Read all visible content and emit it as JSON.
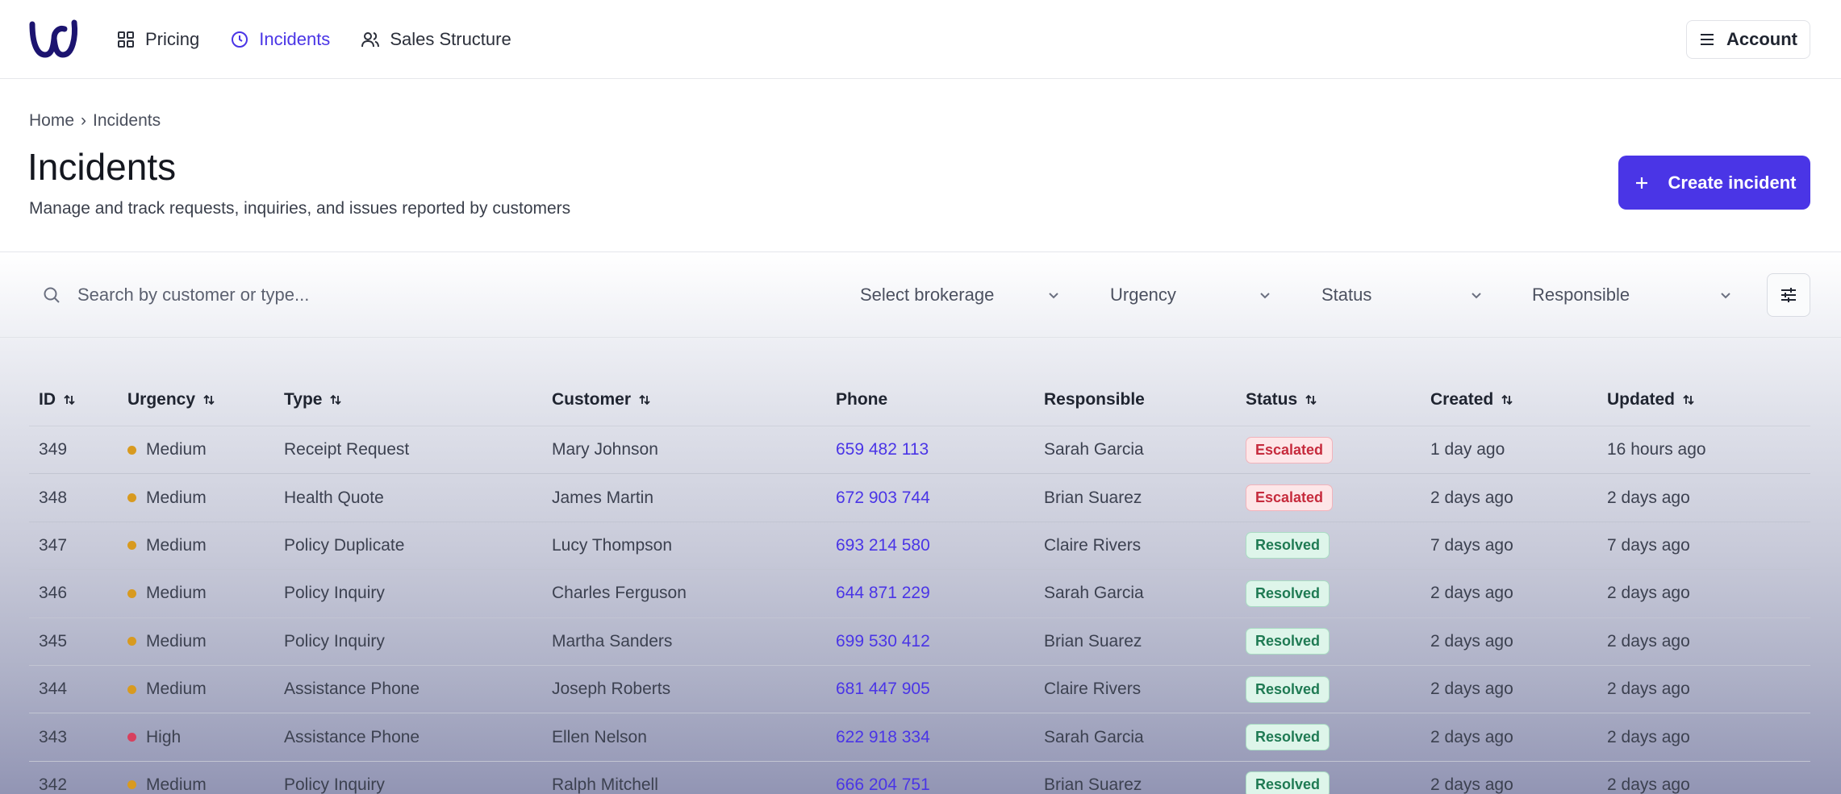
{
  "nav": {
    "items": [
      {
        "label": "Pricing",
        "icon": "grid-icon",
        "active": false
      },
      {
        "label": "Incidents",
        "icon": "clock-icon",
        "active": true
      },
      {
        "label": "Sales Structure",
        "icon": "users-icon",
        "active": false
      }
    ],
    "account_label": "Account"
  },
  "breadcrumb": {
    "home": "Home",
    "separator": "›",
    "current": "Incidents"
  },
  "page": {
    "title": "Incidents",
    "subtitle": "Manage and track requests, inquiries, and issues reported by customers",
    "create_label": "Create incident"
  },
  "filters": {
    "search_placeholder": "Search by customer or type...",
    "brokerage": "Select brokerage",
    "urgency": "Urgency",
    "status": "Status",
    "responsible": "Responsible"
  },
  "table": {
    "columns": [
      "ID",
      "Urgency",
      "Type",
      "Customer",
      "Phone",
      "Responsible",
      "Status",
      "Created",
      "Updated"
    ],
    "rows": [
      {
        "id": "349",
        "urgency": "Medium",
        "type": "Receipt Request",
        "customer": "Mary Johnson",
        "phone": "659 482 113",
        "responsible": "Sarah Garcia",
        "status": "Escalated",
        "created": "1 day ago",
        "updated": "16 hours ago"
      },
      {
        "id": "348",
        "urgency": "Medium",
        "type": "Health Quote",
        "customer": "James Martin",
        "phone": "672 903 744",
        "responsible": "Brian Suarez",
        "status": "Escalated",
        "created": "2 days ago",
        "updated": "2 days ago"
      },
      {
        "id": "347",
        "urgency": "Medium",
        "type": "Policy Duplicate",
        "customer": "Lucy Thompson",
        "phone": "693 214 580",
        "responsible": "Claire Rivers",
        "status": "Resolved",
        "created": "7 days ago",
        "updated": "7 days ago"
      },
      {
        "id": "346",
        "urgency": "Medium",
        "type": "Policy Inquiry",
        "customer": "Charles Ferguson",
        "phone": "644 871 229",
        "responsible": "Sarah Garcia",
        "status": "Resolved",
        "created": "2 days ago",
        "updated": "2 days ago"
      },
      {
        "id": "345",
        "urgency": "Medium",
        "type": "Policy Inquiry",
        "customer": "Martha Sanders",
        "phone": "699 530 412",
        "responsible": "Brian Suarez",
        "status": "Resolved",
        "created": "2 days ago",
        "updated": "2 days ago"
      },
      {
        "id": "344",
        "urgency": "Medium",
        "type": "Assistance Phone",
        "customer": "Joseph Roberts",
        "phone": "681 447 905",
        "responsible": "Claire Rivers",
        "status": "Resolved",
        "created": "2 days ago",
        "updated": "2 days ago"
      },
      {
        "id": "343",
        "urgency": "High",
        "type": "Assistance Phone",
        "customer": "Ellen Nelson",
        "phone": "622 918 334",
        "responsible": "Sarah Garcia",
        "status": "Resolved",
        "created": "2 days ago",
        "updated": "2 days ago"
      },
      {
        "id": "342",
        "urgency": "Medium",
        "type": "Policy Inquiry",
        "customer": "Ralph Mitchell",
        "phone": "666 204 751",
        "responsible": "Brian Suarez",
        "status": "Resolved",
        "created": "2 days ago",
        "updated": "2 days ago"
      }
    ]
  },
  "colors": {
    "accent": "#4a35e6",
    "medium": "#d89a1f",
    "high": "#d8405e",
    "escalated": "#c62b3d",
    "resolved": "#1f7a53"
  }
}
